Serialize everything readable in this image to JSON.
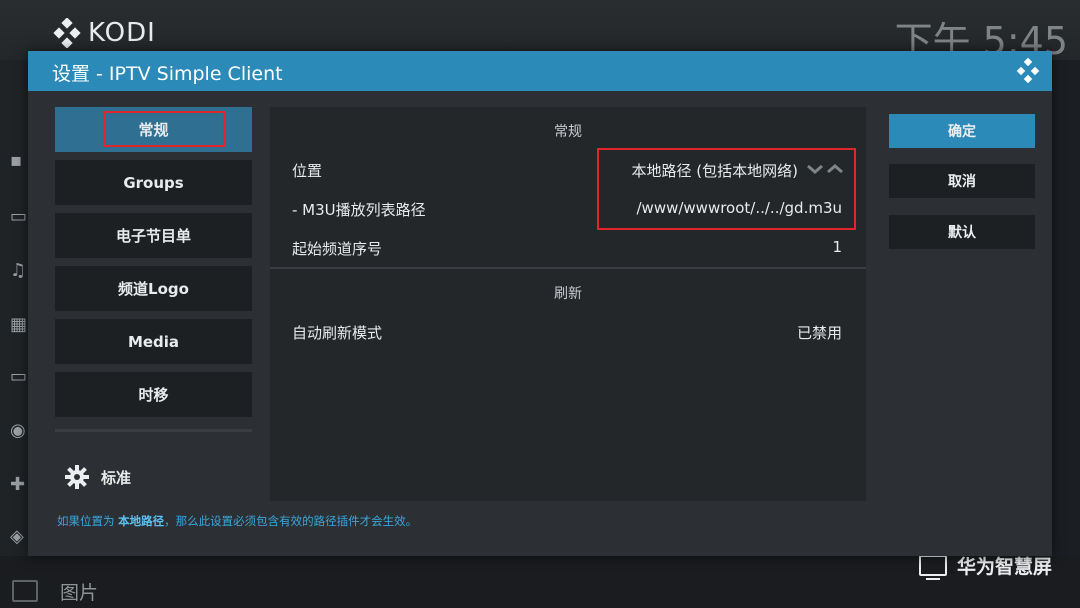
{
  "app": {
    "logo_text": "KODI",
    "clock": "下午 5:45",
    "brand": "华为智慧屏",
    "background_item": "图片"
  },
  "dialog": {
    "title": "设置 - IPTV Simple Client"
  },
  "categories": [
    {
      "label": "常规",
      "active": true
    },
    {
      "label": "Groups",
      "active": false
    },
    {
      "label": "电子节目单",
      "active": false
    },
    {
      "label": "频道Logo",
      "active": false
    },
    {
      "label": "Media",
      "active": false
    },
    {
      "label": "时移",
      "active": false
    }
  ],
  "settings_level": "标准",
  "sections": [
    {
      "header": "常规",
      "rows": [
        {
          "label": "位置",
          "value": "本地路径 (包括本地网络)"
        },
        {
          "label": "- M3U播放列表路径",
          "value": "/www/wwwroot/../../gd.m3u"
        },
        {
          "label": "起始频道序号",
          "value": "1"
        }
      ]
    },
    {
      "header": "刷新",
      "rows": [
        {
          "label": "自动刷新模式",
          "value": "已禁用"
        }
      ]
    }
  ],
  "buttons": {
    "ok": "确定",
    "cancel": "取消",
    "defaults": "默认"
  },
  "hint": {
    "prefix": "如果位置为 ",
    "emphasis": "本地路径",
    "suffix": "，那么此设置必须包含有效的路径插件才会生效。"
  },
  "colors": {
    "accent": "#2b8ab8",
    "highlight_box": "#e0262a",
    "hint_text": "#39a6dc"
  }
}
